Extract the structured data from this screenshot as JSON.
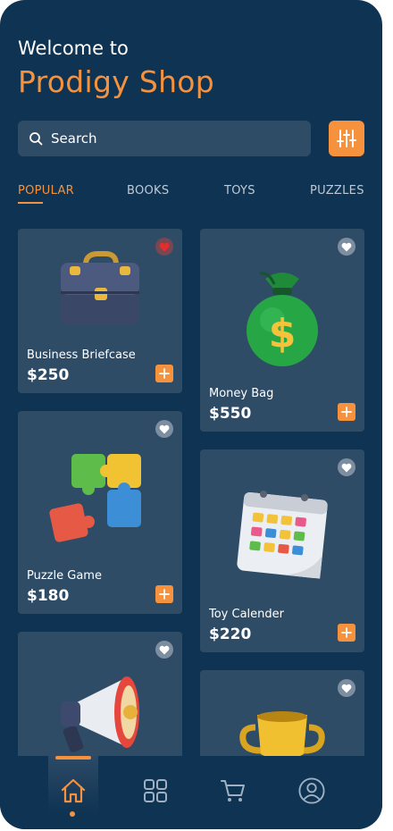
{
  "header": {
    "greeting": "Welcome to",
    "title": "Prodigy Shop"
  },
  "search": {
    "placeholder": "Search",
    "icon": "search-icon"
  },
  "filter_button": {
    "icon": "sliders-icon"
  },
  "tabs": [
    {
      "label": "POPULAR",
      "active": true
    },
    {
      "label": "BOOKS",
      "active": false
    },
    {
      "label": "TOYS",
      "active": false
    },
    {
      "label": "PUZZLES",
      "active": false
    }
  ],
  "products": [
    {
      "name": "Business Briefcase",
      "price": "$250",
      "liked": true,
      "icon": "briefcase-icon"
    },
    {
      "name": "Money Bag",
      "price": "$550",
      "liked": false,
      "icon": "money-bag-icon"
    },
    {
      "name": "Puzzle Game",
      "price": "$180",
      "liked": false,
      "icon": "puzzle-icon"
    },
    {
      "name": "Toy Calender",
      "price": "$220",
      "liked": false,
      "icon": "calendar-icon"
    },
    {
      "name": "",
      "price": "",
      "liked": false,
      "icon": "megaphone-icon"
    },
    {
      "name": "",
      "price": "",
      "liked": false,
      "icon": "trophy-icon"
    }
  ],
  "bottom_nav": [
    {
      "icon": "home-icon",
      "active": true
    },
    {
      "icon": "grid-icon",
      "active": false
    },
    {
      "icon": "cart-icon",
      "active": false
    },
    {
      "icon": "profile-icon",
      "active": false
    }
  ],
  "colors": {
    "background": "#0f3353",
    "card": "#2f4c67",
    "accent": "#f6923d",
    "liked": "#e52d2d"
  }
}
